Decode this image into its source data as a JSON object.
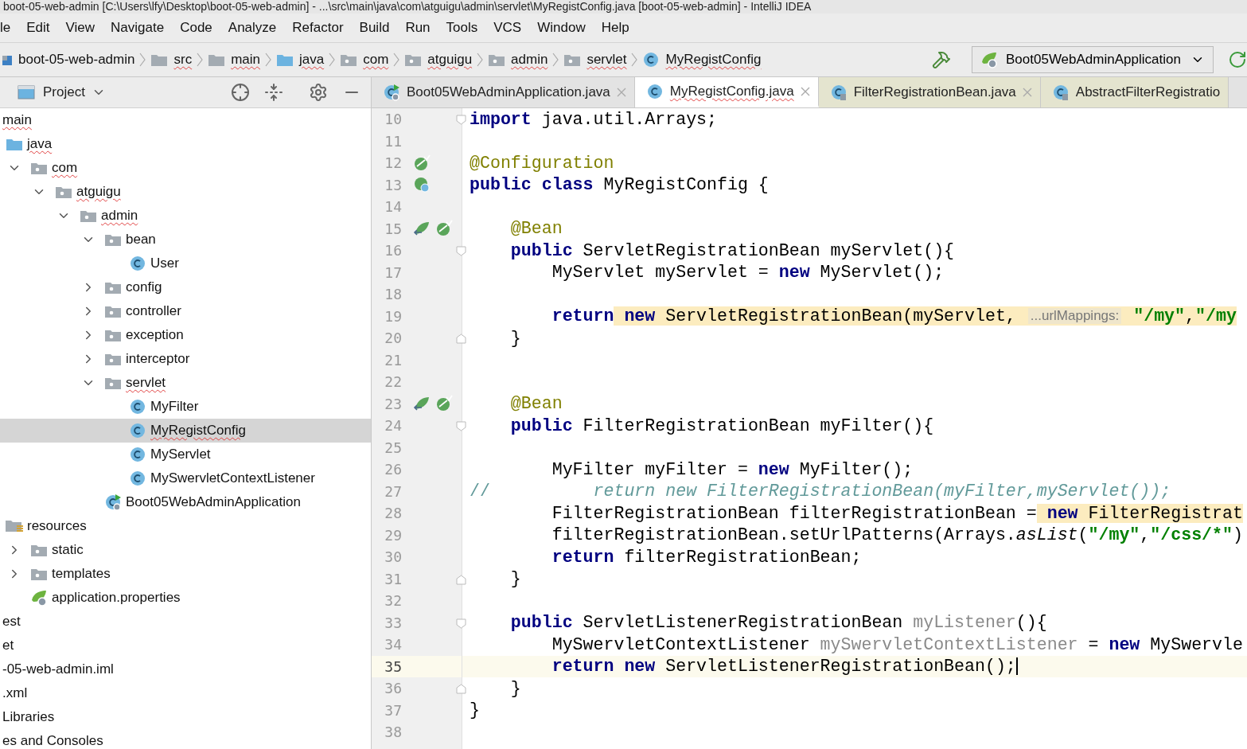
{
  "window": {
    "title": "boot-05-web-admin [C:\\Users\\lfy\\Desktop\\boot-05-web-admin] - ...\\src\\main\\java\\com\\atguigu\\admin\\servlet\\MyRegistConfig.java [boot-05-web-admin] - IntelliJ IDEA"
  },
  "menu": [
    "le",
    "Edit",
    "View",
    "Navigate",
    "Code",
    "Analyze",
    "Refactor",
    "Build",
    "Run",
    "Tools",
    "VCS",
    "Window",
    "Help"
  ],
  "breadcrumbs": [
    {
      "label": "boot-05-web-admin",
      "kind": "module",
      "misspelled": false
    },
    {
      "label": "src",
      "kind": "folder",
      "misspelled": true
    },
    {
      "label": "main",
      "kind": "folder",
      "misspelled": true
    },
    {
      "label": "java",
      "kind": "source-root",
      "misspelled": true
    },
    {
      "label": "com",
      "kind": "package",
      "misspelled": true
    },
    {
      "label": "atguigu",
      "kind": "package",
      "misspelled": true
    },
    {
      "label": "admin",
      "kind": "package",
      "misspelled": true
    },
    {
      "label": "servlet",
      "kind": "package",
      "misspelled": true
    },
    {
      "label": "MyRegistConfig",
      "kind": "class",
      "misspelled": true
    }
  ],
  "run_config": "Boot05WebAdminApplication",
  "project_panel": {
    "title": "Project",
    "tree": [
      {
        "label": "main",
        "selected": false,
        "misspelled": true,
        "children": [
          {
            "label": "java",
            "kind": "source-root",
            "selected": false,
            "misspelled": true,
            "children": [
              {
                "label": "com",
                "kind": "package",
                "expanded": true,
                "selected": false,
                "misspelled": true,
                "children": [
                  {
                    "label": "atguigu",
                    "kind": "package",
                    "expanded": true,
                    "selected": false,
                    "misspelled": true,
                    "children": [
                      {
                        "label": "admin",
                        "kind": "package",
                        "expanded": true,
                        "selected": false,
                        "misspelled": true,
                        "children": [
                          {
                            "label": "bean",
                            "kind": "package",
                            "expanded": true,
                            "selected": false,
                            "misspelled": false,
                            "children": [
                              {
                                "label": "User",
                                "kind": "class",
                                "selected": false,
                                "misspelled": false
                              }
                            ]
                          },
                          {
                            "label": "config",
                            "kind": "package",
                            "expanded": false,
                            "selected": false,
                            "misspelled": false
                          },
                          {
                            "label": "controller",
                            "kind": "package",
                            "expanded": false,
                            "selected": false,
                            "misspelled": false
                          },
                          {
                            "label": "exception",
                            "kind": "package",
                            "expanded": false,
                            "selected": false,
                            "misspelled": false
                          },
                          {
                            "label": "interceptor",
                            "kind": "package",
                            "expanded": false,
                            "selected": false,
                            "misspelled": false
                          },
                          {
                            "label": "servlet",
                            "kind": "package",
                            "expanded": true,
                            "selected": false,
                            "misspelled": true,
                            "children": [
                              {
                                "label": "MyFilter",
                                "kind": "class",
                                "selected": false,
                                "misspelled": false
                              },
                              {
                                "label": "MyRegistConfig",
                                "kind": "class",
                                "selected": true,
                                "misspelled": true
                              },
                              {
                                "label": "MyServlet",
                                "kind": "class",
                                "selected": false,
                                "misspelled": false
                              },
                              {
                                "label": "MySwervletContextListener",
                                "kind": "class",
                                "selected": false,
                                "misspelled": false
                              }
                            ]
                          },
                          {
                            "label": "Boot05WebAdminApplication",
                            "kind": "app",
                            "selected": false,
                            "misspelled": false
                          }
                        ]
                      }
                    ]
                  }
                ]
              }
            ]
          },
          {
            "label": "resources",
            "kind": "resources",
            "selected": false,
            "misspelled": false,
            "children": [
              {
                "label": "static",
                "kind": "package",
                "expanded": false,
                "selected": false,
                "misspelled": false
              },
              {
                "label": "templates",
                "kind": "package",
                "expanded": false,
                "selected": false,
                "misspelled": false
              },
              {
                "label": "application.properties",
                "kind": "properties",
                "selected": false,
                "misspelled": false
              }
            ]
          }
        ]
      },
      {
        "label": "est",
        "selected": false,
        "misspelled": false
      },
      {
        "label": "et",
        "selected": false,
        "misspelled": false
      },
      {
        "label": "-05-web-admin.iml",
        "selected": false,
        "misspelled": false
      },
      {
        "label": ".xml",
        "selected": false,
        "misspelled": false
      },
      {
        "label": "Libraries",
        "selected": false,
        "misspelled": false
      },
      {
        "label": "es and Consoles",
        "selected": false,
        "misspelled": false
      }
    ]
  },
  "editor_tabs": [
    {
      "label": "Boot05WebAdminApplication.java",
      "kind": "app",
      "selected": false,
      "misspelled": false
    },
    {
      "label": "MyRegistConfig.java",
      "kind": "class",
      "selected": true,
      "misspelled": true
    },
    {
      "label": "FilterRegistrationBean.java",
      "kind": "library",
      "selected": false,
      "misspelled": false
    },
    {
      "label": "AbstractFilterRegistratio",
      "kind": "library",
      "selected": false,
      "misspelled": false
    }
  ],
  "code_lines": [
    {
      "n": "10",
      "fold": {
        "kind": "start"
      },
      "current": false,
      "tokens": [
        {
          "kind": "keyword",
          "t": "import"
        },
        {
          "kind": "plain",
          "t": " java.util.Arrays;"
        }
      ]
    },
    {
      "n": "11",
      "current": false
    },
    {
      "n": "12",
      "gutter": [
        {
          "kind": "config"
        }
      ],
      "current": false,
      "tokens": [
        {
          "kind": "annotation",
          "t": "@Configuration"
        }
      ]
    },
    {
      "n": "13",
      "gutter": [
        {
          "kind": "class-bean"
        }
      ],
      "current": false,
      "tokens": [
        {
          "kind": "keyword",
          "t": "public class"
        },
        {
          "kind": "plain",
          "t": " MyRegistConfig {"
        }
      ]
    },
    {
      "n": "14",
      "current": false
    },
    {
      "n": "15",
      "gutter": [
        {
          "kind": "bean-ref"
        },
        {
          "kind": "config"
        }
      ],
      "current": false,
      "tokens": [
        {
          "kind": "annotation",
          "t": "    @Bean"
        }
      ]
    },
    {
      "n": "16",
      "fold": {
        "kind": "start"
      },
      "current": false,
      "tokens": [
        {
          "kind": "keyword",
          "t": "    public"
        },
        {
          "kind": "plain",
          "t": " ServletRegistrationBean myServlet(){"
        }
      ]
    },
    {
      "n": "17",
      "current": false,
      "tokens": [
        {
          "kind": "plain",
          "t": "        MyServlet myServlet = "
        },
        {
          "kind": "keyword",
          "t": "new"
        },
        {
          "kind": "plain",
          "t": " MyServlet();"
        }
      ]
    },
    {
      "n": "18",
      "current": false
    },
    {
      "n": "19",
      "current": false,
      "tokens": [
        {
          "kind": "keyword",
          "t": "        return"
        }
      ],
      "match": [
        {
          "kind": "keyword",
          "t": " new"
        },
        {
          "kind": "plain",
          "t": " ServletRegistrationBean(myServlet, "
        },
        {
          "kind": "hint",
          "t": "...urlMappings:"
        },
        {
          "kind": "string",
          "t": " \"/my\""
        },
        {
          "kind": "plain",
          "t": ","
        },
        {
          "kind": "string",
          "t": "\"/my"
        }
      ]
    },
    {
      "n": "20",
      "fold": {
        "kind": "end"
      },
      "current": false,
      "tokens": [
        {
          "kind": "plain",
          "t": "    }"
        }
      ]
    },
    {
      "n": "21",
      "current": false
    },
    {
      "n": "22",
      "current": false
    },
    {
      "n": "23",
      "gutter": [
        {
          "kind": "bean-ref"
        },
        {
          "kind": "config"
        }
      ],
      "current": false,
      "tokens": [
        {
          "kind": "annotation",
          "t": "    @Bean"
        }
      ]
    },
    {
      "n": "24",
      "fold": {
        "kind": "start"
      },
      "current": false,
      "tokens": [
        {
          "kind": "keyword",
          "t": "    public"
        },
        {
          "kind": "plain",
          "t": " FilterRegistrationBean myFilter(){"
        }
      ]
    },
    {
      "n": "25",
      "current": false
    },
    {
      "n": "26",
      "current": false,
      "tokens": [
        {
          "kind": "plain",
          "t": "        MyFilter myFilter = "
        },
        {
          "kind": "keyword",
          "t": "new"
        },
        {
          "kind": "plain",
          "t": " MyFilter();"
        }
      ]
    },
    {
      "n": "27",
      "current": false,
      "tokens": [
        {
          "kind": "comment-mark",
          "t": "//"
        },
        {
          "kind": "comment",
          "t": "          return new FilterRegistrationBean(myFilter,myServlet());"
        }
      ]
    },
    {
      "n": "28",
      "current": false,
      "tokens": [
        {
          "kind": "plain",
          "t": "        FilterRegistrationBean filterRegistrationBean ="
        }
      ],
      "match": [
        {
          "kind": "keyword",
          "t": " new"
        },
        {
          "kind": "plain",
          "t": " FilterRegistrat"
        }
      ]
    },
    {
      "n": "29",
      "current": false,
      "tokens": [
        {
          "kind": "plain",
          "t": "        filterRegistrationBean.setUrlPatterns(Arrays."
        },
        {
          "kind": "italic",
          "t": "asList"
        },
        {
          "kind": "plain",
          "t": "("
        },
        {
          "kind": "string",
          "t": "\"/my\""
        },
        {
          "kind": "plain",
          "t": ","
        },
        {
          "kind": "string",
          "t": "\"/css/*\""
        },
        {
          "kind": "plain",
          "t": ")"
        }
      ]
    },
    {
      "n": "30",
      "current": false,
      "tokens": [
        {
          "kind": "keyword",
          "t": "        return"
        },
        {
          "kind": "plain",
          "t": " filterRegistrationBean;"
        }
      ]
    },
    {
      "n": "31",
      "fold": {
        "kind": "end"
      },
      "current": false,
      "tokens": [
        {
          "kind": "plain",
          "t": "    }"
        }
      ]
    },
    {
      "n": "32",
      "current": false
    },
    {
      "n": "33",
      "fold": {
        "kind": "start"
      },
      "current": false,
      "tokens": [
        {
          "kind": "keyword",
          "t": "    public"
        },
        {
          "kind": "plain",
          "t": " ServletListenerRegistrationBean "
        },
        {
          "kind": "unused",
          "t": "myListener"
        },
        {
          "kind": "plain",
          "t": "(){"
        }
      ]
    },
    {
      "n": "34",
      "current": false,
      "tokens": [
        {
          "kind": "plain",
          "t": "        MySwervletContextListener "
        },
        {
          "kind": "unused",
          "t": "mySwervletContextListener"
        },
        {
          "kind": "plain",
          "t": " = "
        },
        {
          "kind": "keyword",
          "t": "new"
        },
        {
          "kind": "plain",
          "t": " MySwervle"
        }
      ]
    },
    {
      "n": "35",
      "current": true,
      "tokens": [
        {
          "kind": "keyword",
          "t": "        return new"
        },
        {
          "kind": "plain",
          "t": " ServletListenerRegistrationBean();"
        }
      ]
    },
    {
      "n": "36",
      "fold": {
        "kind": "end"
      },
      "current": false,
      "tokens": [
        {
          "kind": "plain",
          "t": "    }"
        }
      ]
    },
    {
      "n": "37",
      "current": false,
      "tokens": [
        {
          "kind": "plain",
          "t": "}"
        }
      ]
    },
    {
      "n": "38",
      "current": false
    }
  ]
}
